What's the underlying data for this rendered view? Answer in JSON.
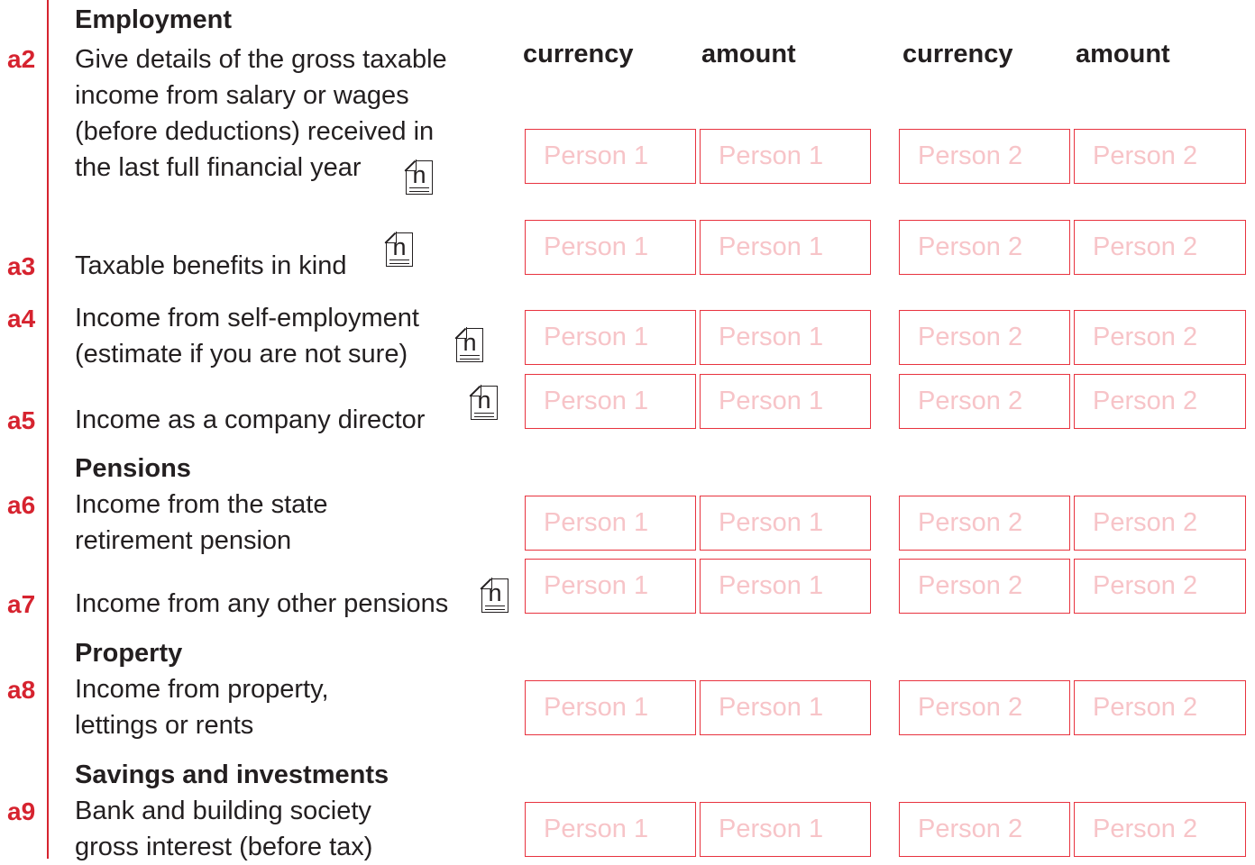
{
  "columns": {
    "p1_currency": "currency",
    "p1_amount": "amount",
    "p2_currency": "currency",
    "p2_amount": "amount"
  },
  "note_glyph": "n",
  "sections": {
    "employment": "Employment",
    "pensions": "Pensions",
    "property": "Property",
    "savings": "Savings and investments"
  },
  "rows": [
    {
      "code": "a2",
      "lines": [
        "Give details of the gross taxable",
        "income from salary or wages",
        "(before deductions) received in",
        "the last full financial year"
      ],
      "has_note": true
    },
    {
      "code": "a3",
      "lines": [
        "Taxable benefits in kind"
      ],
      "has_note": true
    },
    {
      "code": "a4",
      "lines": [
        "Income from self-employment",
        "(estimate if you are not sure)"
      ],
      "has_note": true
    },
    {
      "code": "a5",
      "lines": [
        "Income as a company director"
      ],
      "has_note": true
    },
    {
      "code": "a6",
      "lines": [
        "Income from the state",
        "retirement pension"
      ],
      "has_note": false
    },
    {
      "code": "a7",
      "lines": [
        "Income from any other pensions"
      ],
      "has_note": true
    },
    {
      "code": "a8",
      "lines": [
        "Income from property,",
        "lettings or rents"
      ],
      "has_note": false
    },
    {
      "code": "a9",
      "lines": [
        "Bank and building society",
        "gross interest (before tax)"
      ],
      "has_note": false
    }
  ],
  "placeholders": {
    "person1": "Person 1",
    "person2": "Person 2"
  },
  "colors": {
    "accent": "#d6232f",
    "field_border": "#e8333f",
    "placeholder": "#f7c4c8",
    "text": "#231f20"
  }
}
